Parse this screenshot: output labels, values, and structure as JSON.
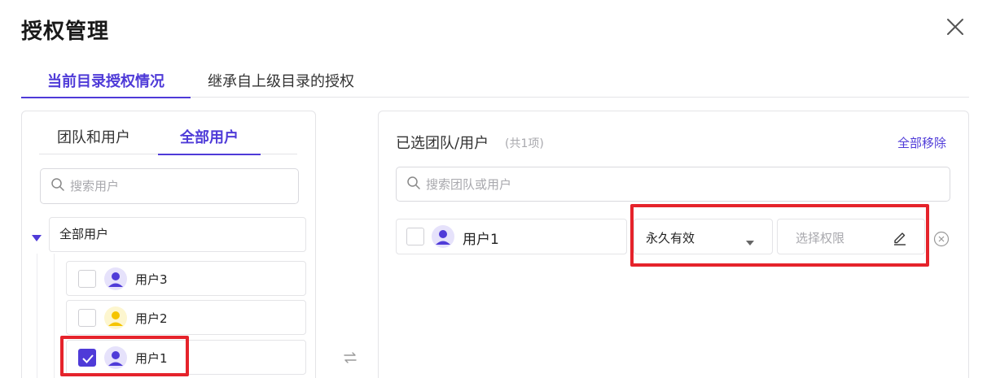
{
  "dialog": {
    "title": "授权管理",
    "close_icon": "close-icon"
  },
  "main_tabs": [
    {
      "label": "当前目录授权情况",
      "active": true
    },
    {
      "label": "继承自上级目录的授权",
      "active": false
    }
  ],
  "left": {
    "sub_tabs": [
      {
        "label": "团队和用户",
        "active": false
      },
      {
        "label": "全部用户",
        "active": true
      }
    ],
    "search": {
      "placeholder": "搜索用户",
      "value": ""
    },
    "tree": {
      "root_label": "全部用户",
      "users": [
        {
          "name": "用户3",
          "checked": false,
          "avatar_color": "#4f3bd8",
          "avatar_bg": "#e6e2fb"
        },
        {
          "name": "用户2",
          "checked": false,
          "avatar_color": "#f5c400",
          "avatar_bg": "#fdf6cf"
        },
        {
          "name": "用户1",
          "checked": true,
          "avatar_color": "#4f3bd8",
          "avatar_bg": "#e6e2fb"
        }
      ]
    }
  },
  "right": {
    "title": "已选团队/用户",
    "count": "(共1项)",
    "remove_all": "全部移除",
    "search": {
      "placeholder": "搜索团队或用户",
      "value": ""
    },
    "selected": [
      {
        "name": "用户1",
        "validity": "永久有效",
        "permission_placeholder": "选择权限"
      }
    ]
  },
  "colors": {
    "accent": "#4f3bd8",
    "highlight": "#e5232b",
    "border": "#e4e4e7"
  }
}
